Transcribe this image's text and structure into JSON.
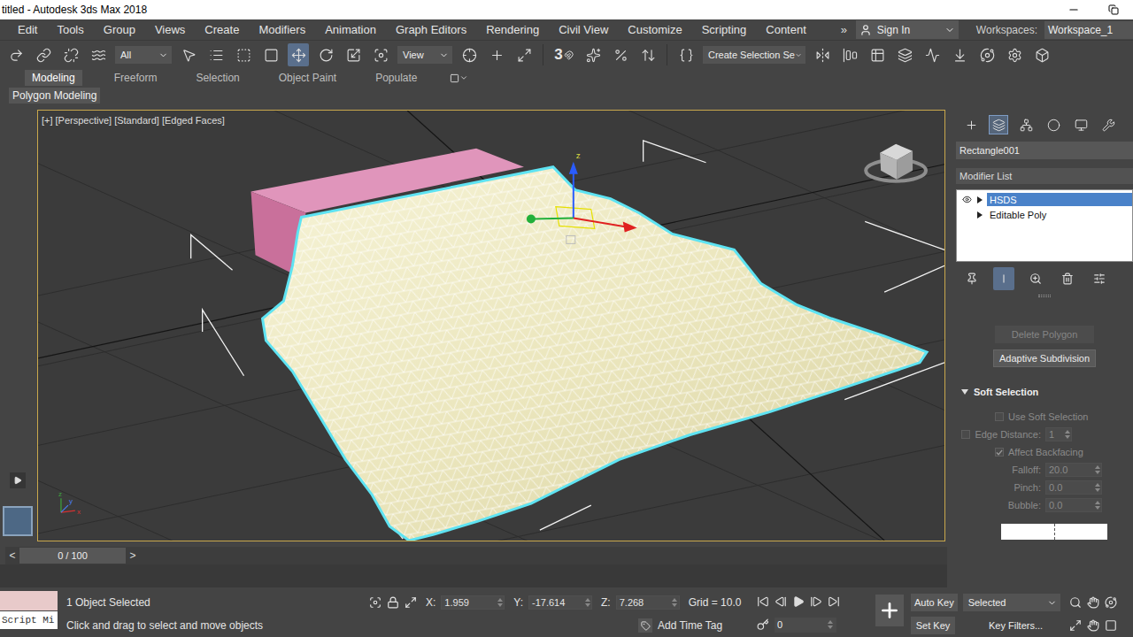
{
  "window": {
    "title": "titled - Autodesk 3ds Max 2018"
  },
  "menu": {
    "items": [
      "Edit",
      "Tools",
      "Group",
      "Views",
      "Create",
      "Modifiers",
      "Animation",
      "Graph Editors",
      "Rendering",
      "Civil View",
      "Customize",
      "Scripting",
      "Content"
    ],
    "overflow": "»"
  },
  "account": {
    "label": "Sign In"
  },
  "workspaces": {
    "label": "Workspaces:",
    "value": "Workspace_1"
  },
  "toolbar": {
    "filter": "All",
    "reference_coordinate": "View",
    "snap": "3",
    "selection_set": "Create Selection Se"
  },
  "ribbon": {
    "tabs": [
      {
        "label": "Modeling",
        "selected": true
      },
      {
        "label": "Freeform",
        "selected": false
      },
      {
        "label": "Selection",
        "selected": false
      },
      {
        "label": "Object Paint",
        "selected": false
      },
      {
        "label": "Populate",
        "selected": false
      }
    ],
    "panel": "Polygon Modeling"
  },
  "viewport": {
    "labels": [
      "[+]",
      "[Perspective]",
      "[Standard]",
      "[Edged Faces]"
    ],
    "active": true,
    "gizmo_axis": "z",
    "axis_tripod": [
      "x",
      "y",
      "z"
    ]
  },
  "command_panel": {
    "tabs": [
      {
        "kind": "create",
        "selected": false
      },
      {
        "kind": "modify",
        "selected": true
      },
      {
        "kind": "hierarchy",
        "selected": false
      },
      {
        "kind": "motion",
        "selected": false
      },
      {
        "kind": "display",
        "selected": false
      },
      {
        "kind": "utilities",
        "selected": false
      }
    ],
    "object_name": "Rectangle001",
    "modifier_list": "Modifier List",
    "stack": [
      {
        "label": "HSDS",
        "selected": true,
        "expanded": false,
        "visible": true
      },
      {
        "label": "Editable Poly",
        "selected": false,
        "expanded": false
      }
    ],
    "buttons": [
      {
        "label": "Delete Polygon",
        "disabled": true
      },
      {
        "label": "Adaptive Subdivision",
        "disabled": false
      }
    ],
    "rollout": {
      "title": "Soft Selection",
      "expanded": true,
      "rows": [
        {
          "kind": "checkbox",
          "label": "Use Soft Selection",
          "checked": false,
          "disabled": true
        },
        {
          "kind": "toggle-spinner",
          "label": "Edge Distance:",
          "checked": false,
          "value": "1",
          "disabled": true
        },
        {
          "kind": "checkbox",
          "label": "Affect Backfacing",
          "checked": true,
          "disabled": true
        },
        {
          "kind": "spinner",
          "label": "Falloff:",
          "value": "20.0",
          "disabled": true
        },
        {
          "kind": "spinner",
          "label": "Pinch:",
          "value": "0.0",
          "disabled": true
        },
        {
          "kind": "spinner",
          "label": "Bubble:",
          "value": "0.0",
          "disabled": true
        }
      ]
    }
  },
  "timeline": {
    "prev": "<",
    "position": "0 / 100",
    "next": ">",
    "level": 0
  },
  "status": {
    "script": "Script Mi",
    "selection": "1 Object Selected",
    "prompt": "Click and drag to select and move objects",
    "coordinates": [
      {
        "axis": "X:",
        "value": "1.959"
      },
      {
        "axis": "Y:",
        "value": "-17.614"
      },
      {
        "axis": "Z:",
        "value": "7.268"
      }
    ],
    "grid": "Grid = 10.0",
    "time_tag": "Add Time Tag",
    "frame": "0",
    "auto_key": {
      "label": "Auto Key",
      "on": false
    },
    "key_mode": "Selected",
    "set_key": "Set Key",
    "key_filters": "Key Filters..."
  }
}
